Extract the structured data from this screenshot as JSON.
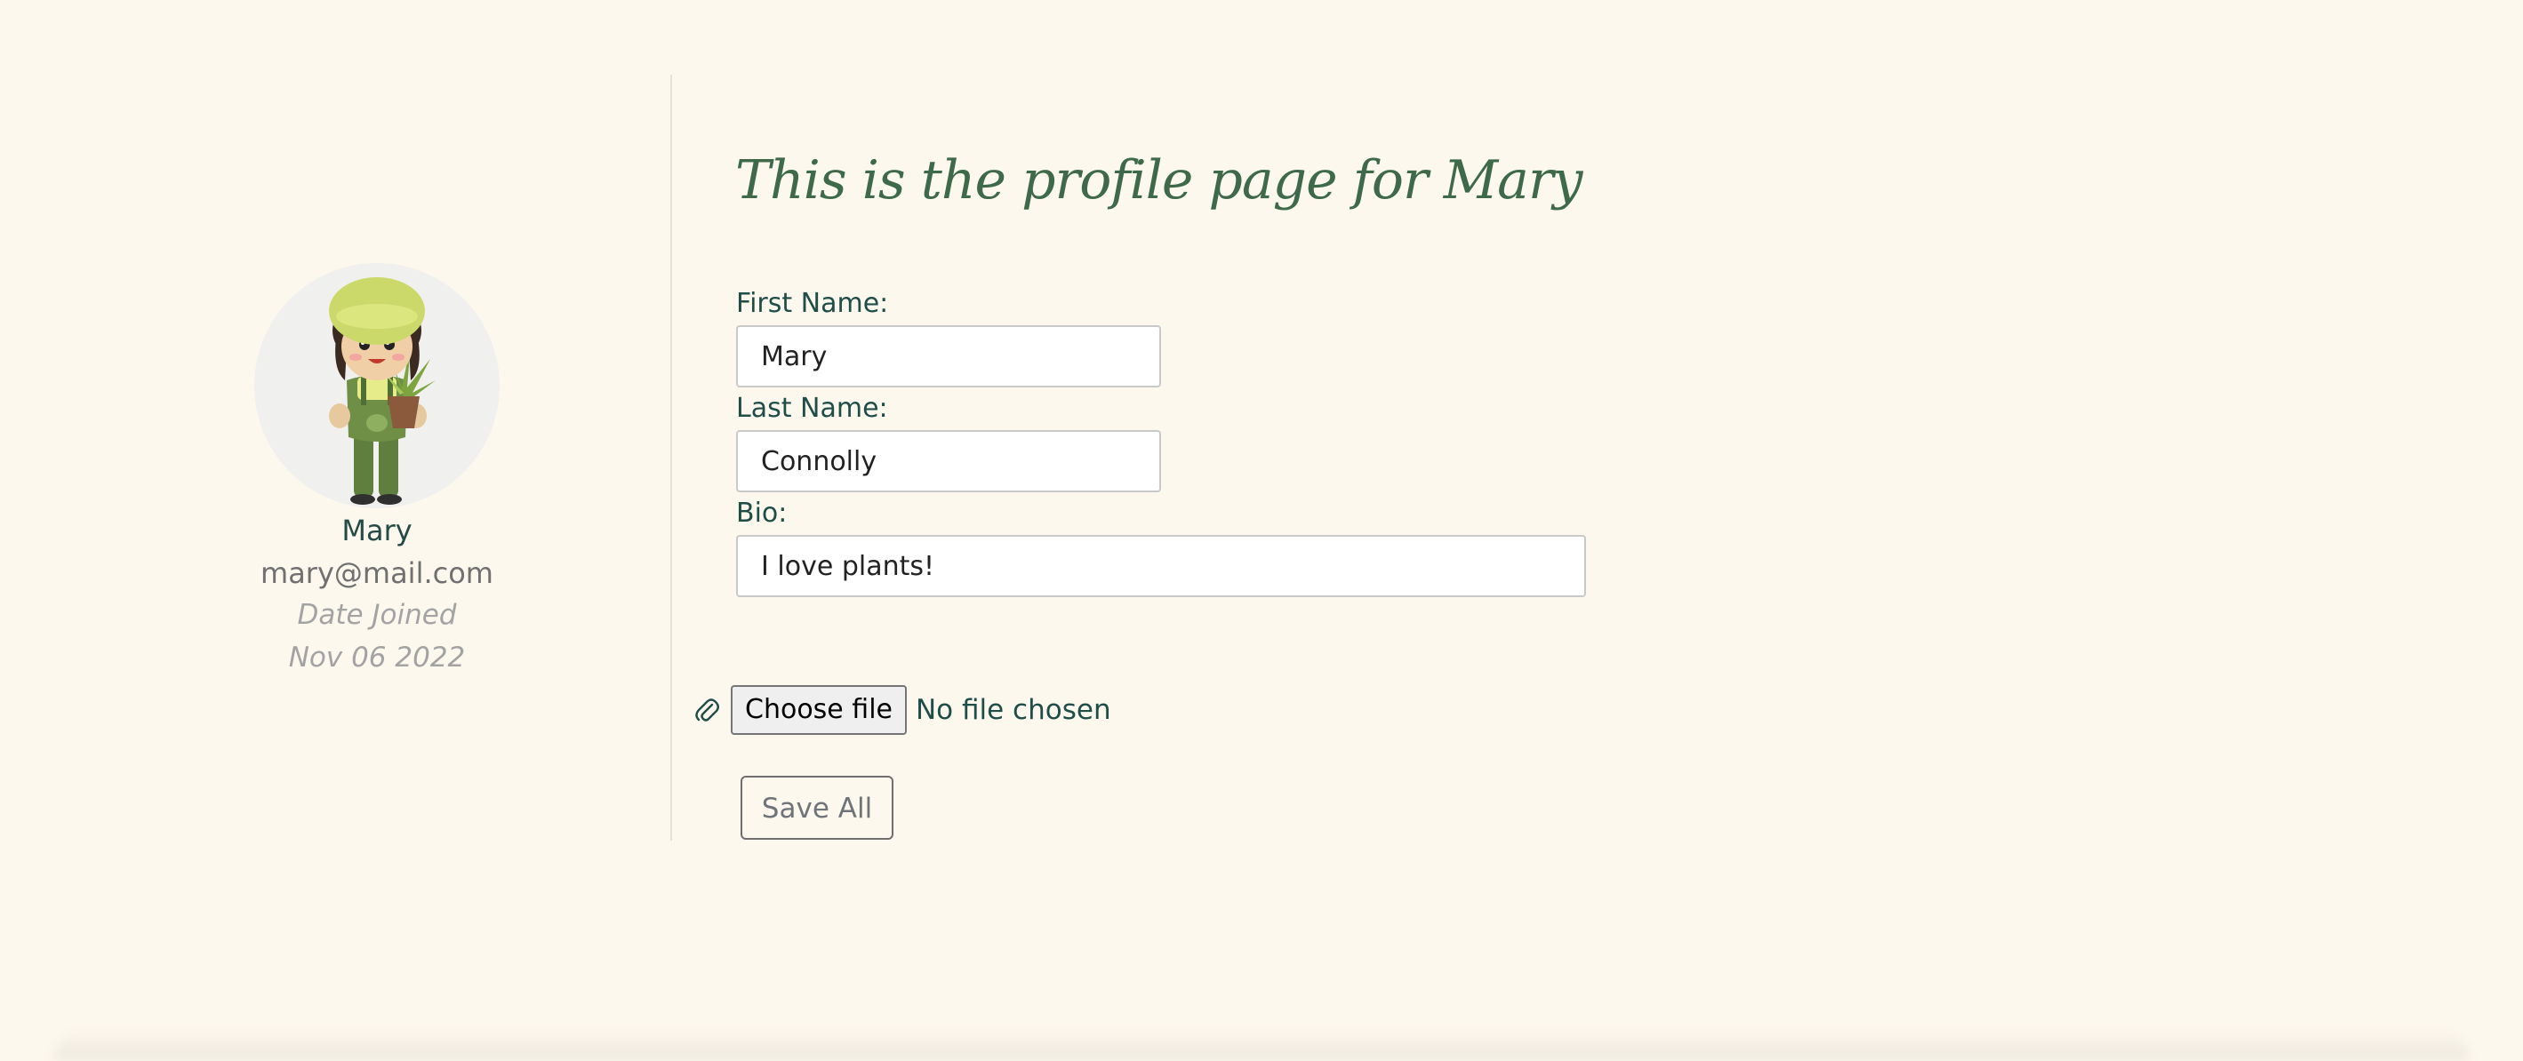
{
  "profile": {
    "name": "Mary",
    "email": "mary@mail.com",
    "date_joined_label": "Date Joined",
    "date_joined": "Nov 06 2022",
    "avatar_icon": "gardener-avatar-icon"
  },
  "form": {
    "title": "This is the profile page for Mary",
    "first_name_label": "First Name:",
    "first_name_value": "Mary",
    "last_name_label": "Last Name:",
    "last_name_value": "Connolly",
    "bio_label": "Bio:",
    "bio_value": "I love plants!",
    "file_icon": "paperclip-icon",
    "choose_file_label": "Choose file",
    "file_status": "No file chosen",
    "save_label": "Save All"
  },
  "colors": {
    "background": "#fdf8ee",
    "title": "#3e6a4a",
    "label": "#1f4d47"
  }
}
